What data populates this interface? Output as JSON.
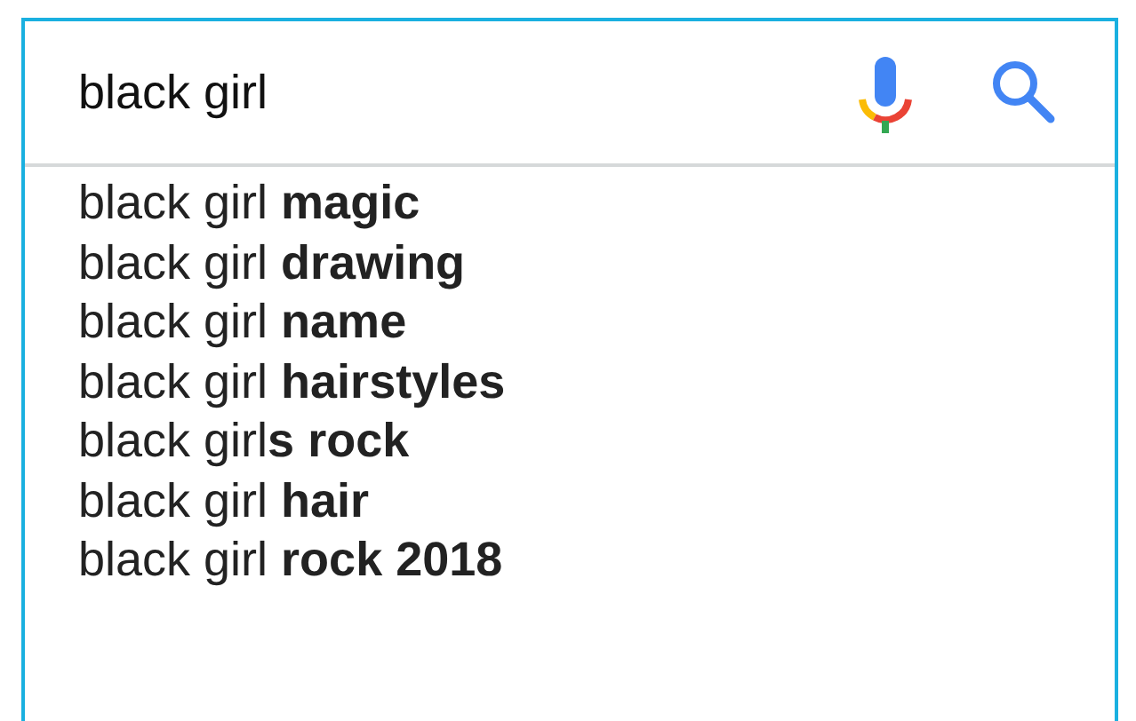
{
  "search": {
    "value": "black girl"
  },
  "suggestions": [
    "black girl **magic**",
    "black girl **drawing**",
    "black girl **name**",
    "black girl **hairstyles**",
    "black girl**s rock**",
    "black girl **hair**",
    "black girl **rock 2018**"
  ]
}
